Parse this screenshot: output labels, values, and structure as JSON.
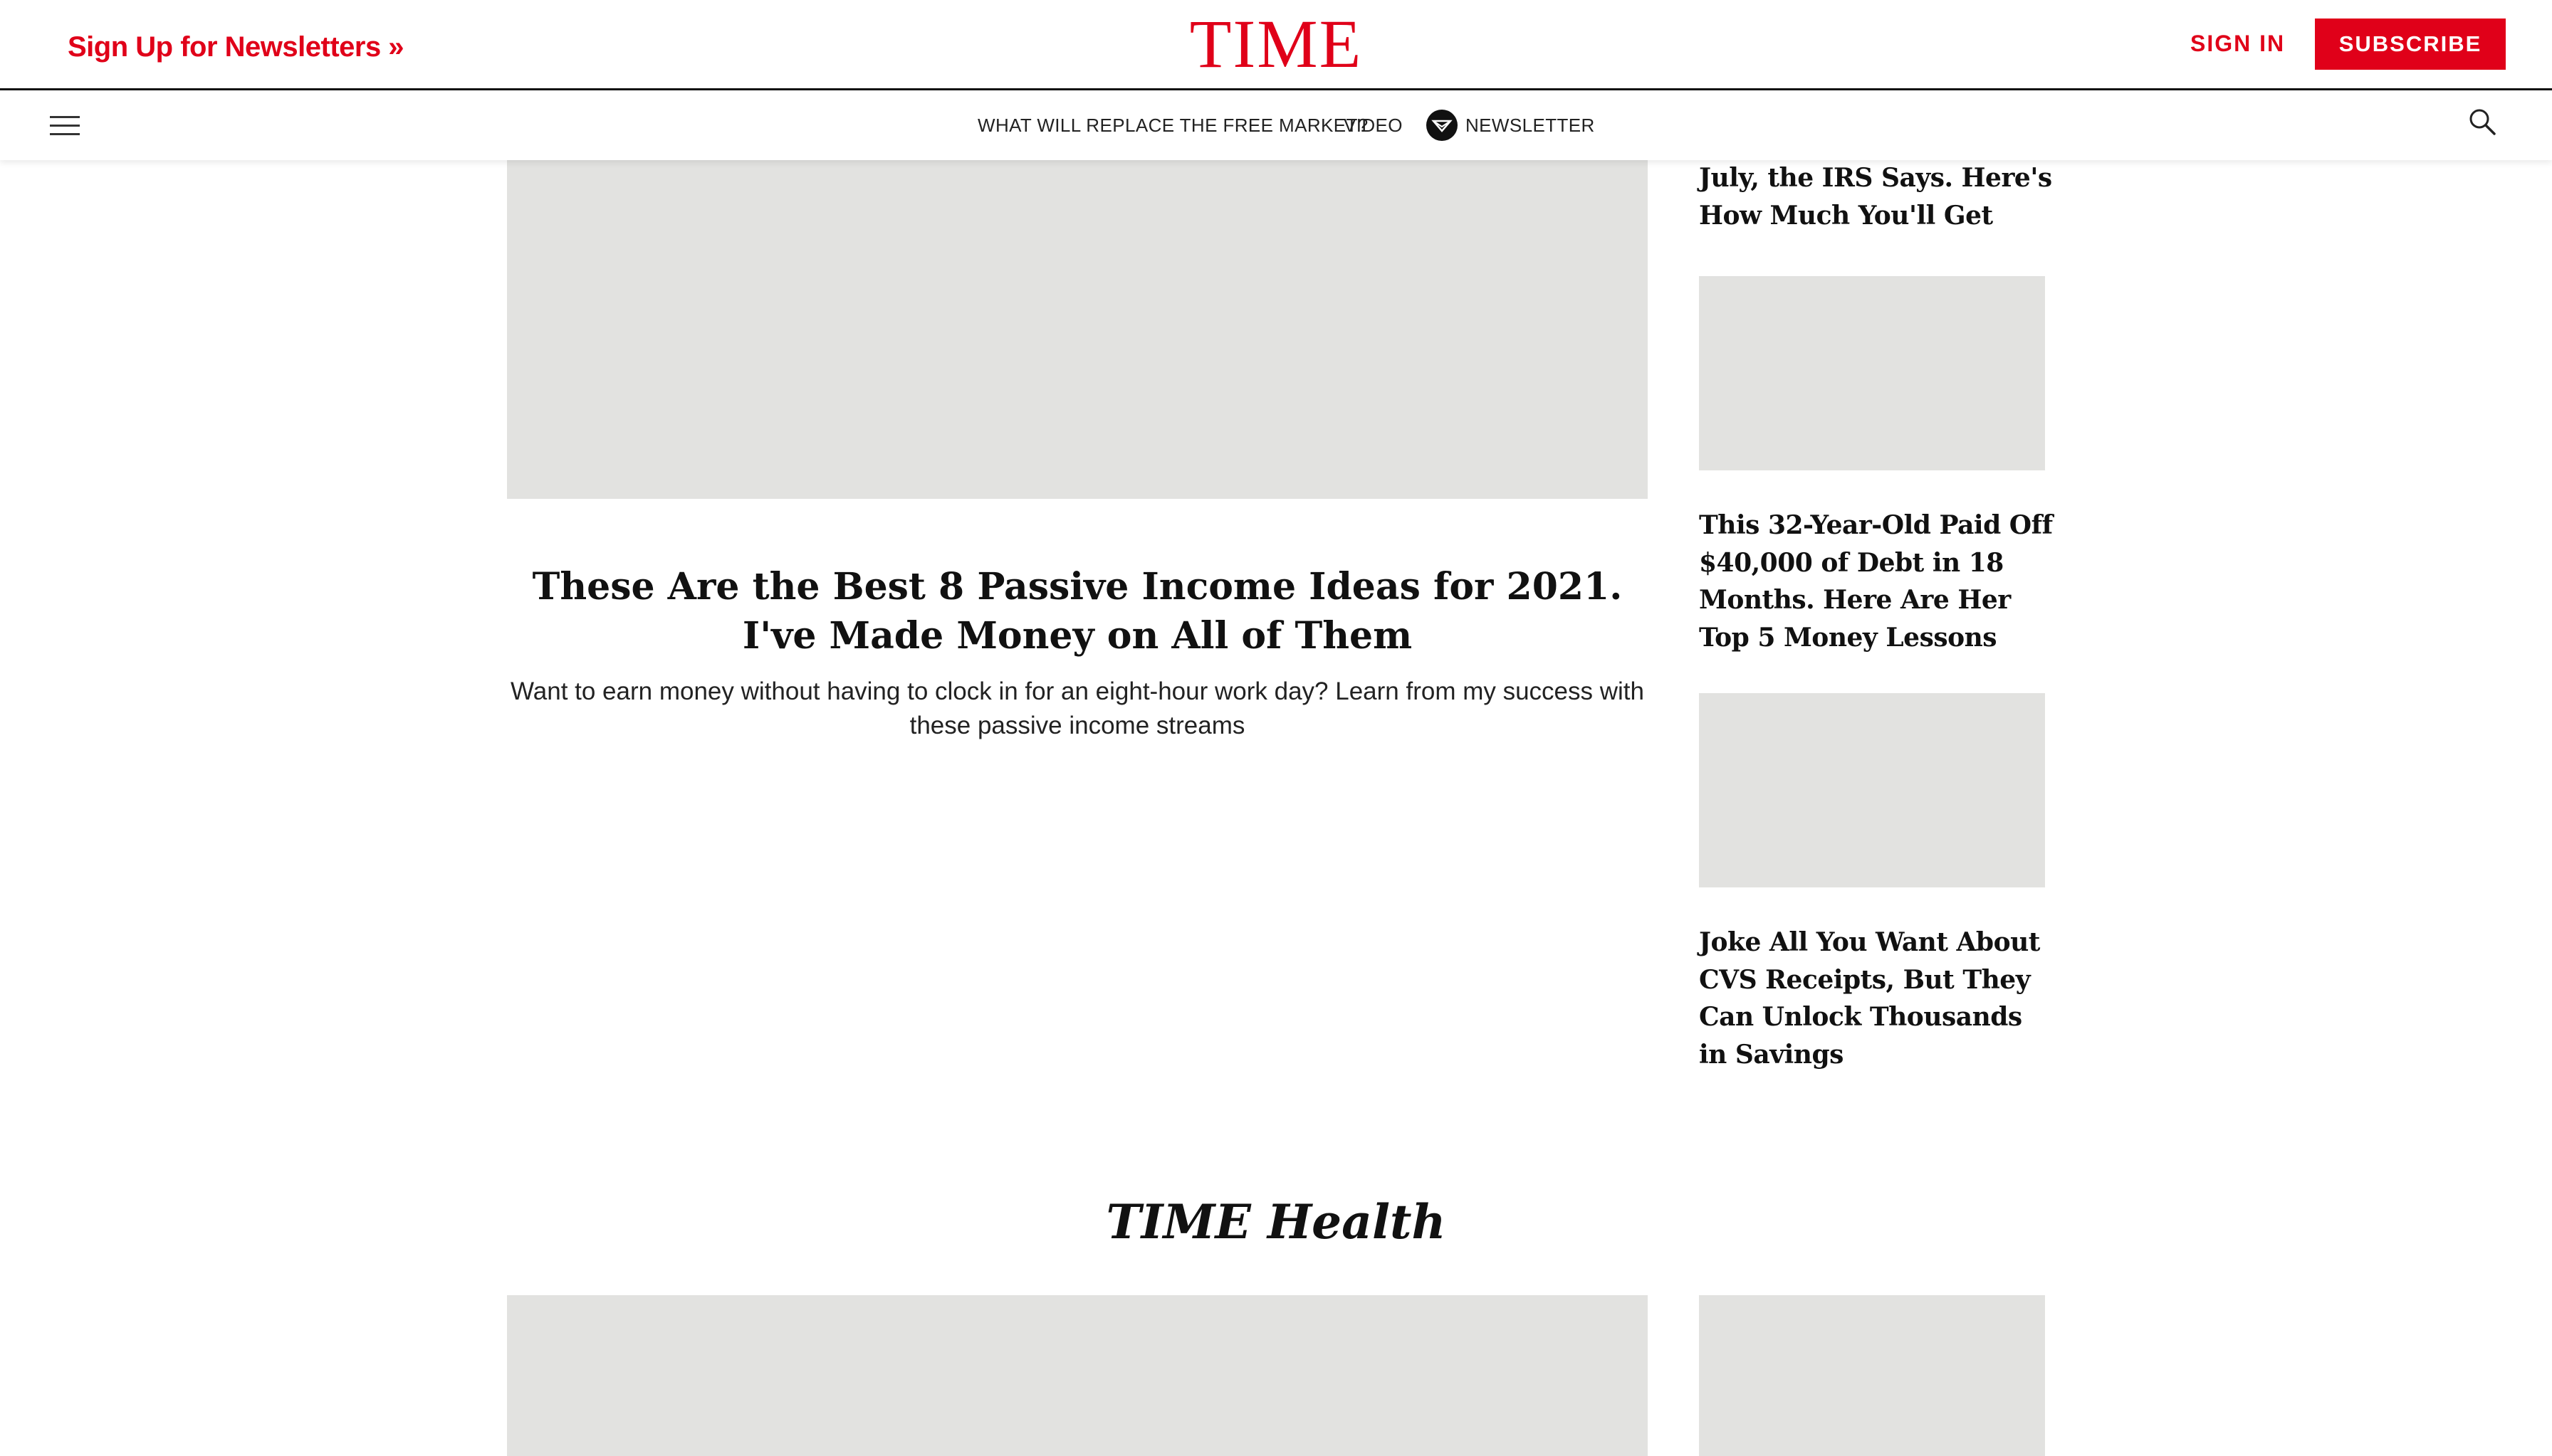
{
  "header": {
    "newsletter_signup": "Sign Up for Newsletters »",
    "logo": "TIME",
    "sign_in": "SIGN IN",
    "subscribe": "SUBSCRIBE"
  },
  "nav": {
    "items": [
      {
        "label": "WHAT WILL REPLACE THE FREE MARKET?"
      },
      {
        "label": "VIDEO"
      },
      {
        "label": "NEWSLETTER"
      }
    ]
  },
  "main": {
    "featured": {
      "title": "These Are the Best 8 Passive Income Ideas for 2021. I've Made Money on All of Them",
      "description": "Want to earn money without having to clock in for an eight-hour work day? Learn from my success with these passive income streams"
    },
    "sidebar": [
      {
        "title": "July, the IRS Says. Here's How Much You'll Get"
      },
      {
        "title": "This 32-Year-Old Paid Off $40,000 of Debt in 18 Months. Here Are Her Top 5 Money Lessons"
      },
      {
        "title": "Joke All You Want About CVS Receipts, But They Can Unlock Thousands in Savings"
      }
    ]
  },
  "section": {
    "title": "TIME Health"
  },
  "icons": {
    "menu": "hamburger-menu-icon",
    "newsletter": "newsletter-icon",
    "search": "search-icon"
  },
  "colors": {
    "brand_red": "#e00019",
    "placeholder_gray": "#e2e2e0"
  }
}
